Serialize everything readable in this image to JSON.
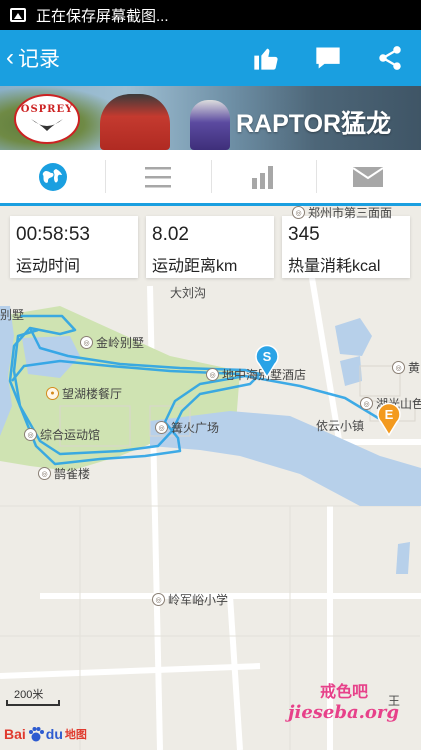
{
  "status_bar": {
    "text": "正在保存屏幕截图..."
  },
  "header": {
    "back_label": "记录"
  },
  "banner": {
    "logo_text": "OSPREY",
    "slogan": "RAPTOR猛龙"
  },
  "tabs": [
    {
      "name": "map",
      "icon": "globe-icon",
      "active": true
    },
    {
      "name": "list",
      "icon": "list-icon",
      "active": false
    },
    {
      "name": "chart",
      "icon": "bar-chart-icon",
      "active": false
    },
    {
      "name": "message",
      "icon": "envelope-icon",
      "active": false
    }
  ],
  "stats": [
    {
      "value": "00:58:53",
      "label": "运动时间"
    },
    {
      "value": "8.02",
      "label": "运动距离km"
    },
    {
      "value": "345",
      "label": "热量消耗kcal"
    }
  ],
  "map": {
    "labels": {
      "top_road": "郑州市第三面面",
      "dalitou": "大刘沟",
      "bieshu_cut": "别墅",
      "jinling": "金岭别墅",
      "wangxun": "望湖楼餐厅",
      "zonghe": "综合运动馆",
      "queque": "鹊雀楼",
      "dihai": "地中海别墅酒店",
      "square": "篝火广场",
      "yiyun": "依云小镇",
      "huangpu": "黄",
      "hupanshan": "湖光山色",
      "school": "岭军峪小学",
      "bottom_right": "王"
    },
    "start_marker": "S",
    "end_marker": "E",
    "scale_label": "200米",
    "baidu": {
      "bai": "Bai",
      "du": "du",
      "ditu": "地图"
    }
  },
  "watermark": {
    "top": "戒色吧",
    "bottom": "jieseba.org"
  },
  "colors": {
    "accent": "#1a9fe0",
    "route": "#2aa3e6",
    "water": "#b7d0ea",
    "park": "#cfe3b2",
    "end_marker": "#f39a1f"
  }
}
